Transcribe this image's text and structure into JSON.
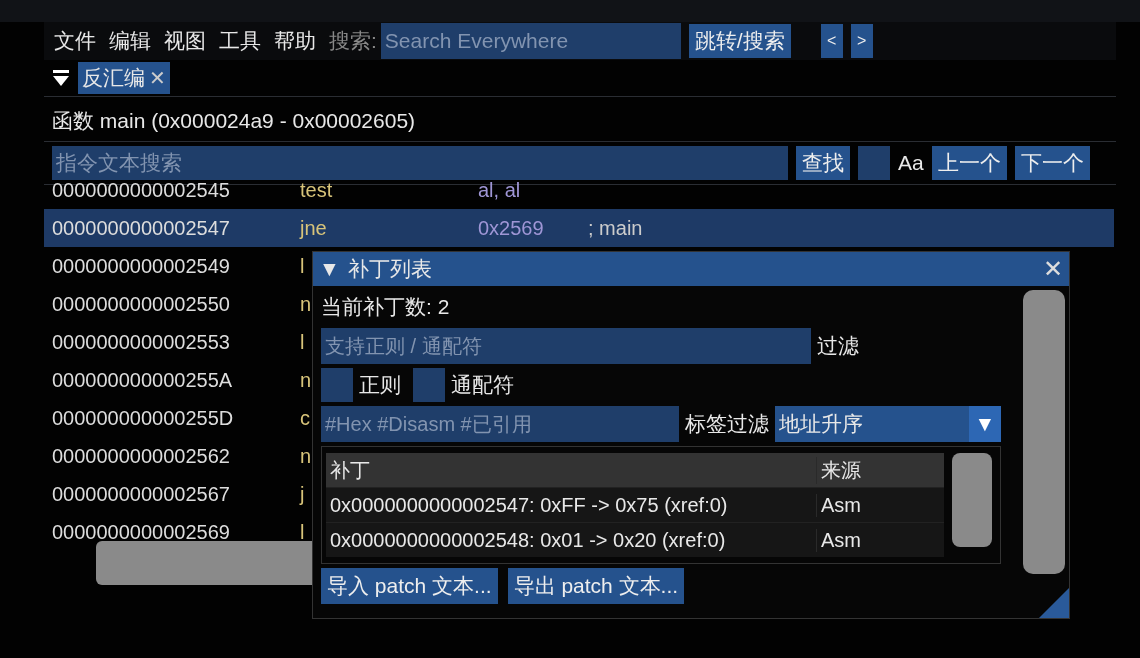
{
  "menu": [
    {
      "label": "文件"
    },
    {
      "label": "编辑"
    },
    {
      "label": "视图"
    },
    {
      "label": "工具"
    },
    {
      "label": "帮助"
    }
  ],
  "search": {
    "label": "搜索:",
    "placeholder": "Search Everywhere",
    "button": "跳转/搜索",
    "back": "<",
    "forward": ">"
  },
  "tabs": [
    {
      "label": "反汇编",
      "selected": true,
      "close": "✕"
    }
  ],
  "function_header": "函数 main  (0x000024a9 - 0x00002605)",
  "find": {
    "placeholder": "指令文本搜索",
    "button": "查找",
    "case_label": "Aa",
    "case_checked": false,
    "prev": "上一个",
    "next": "下一个"
  },
  "rows": [
    {
      "address": "0000000000002545",
      "mnemonic": "test",
      "operands": "al, al",
      "comment": "",
      "selected": false
    },
    {
      "address": "0000000000002547",
      "mnemonic": "jne",
      "operands": "0x2569",
      "comment": "; main",
      "selected": true
    },
    {
      "address": "0000000000002549",
      "mnemonic": "l",
      "operands": "",
      "comment": "",
      "selected": false
    },
    {
      "address": "0000000000002550",
      "mnemonic": "n",
      "operands": "",
      "comment": "",
      "selected": false
    },
    {
      "address": "0000000000002553",
      "mnemonic": "l",
      "operands": "",
      "comment": "",
      "selected": false
    },
    {
      "address": "000000000000255A",
      "mnemonic": "n",
      "operands": "",
      "comment": "",
      "selected": false
    },
    {
      "address": "000000000000255D",
      "mnemonic": "c",
      "operands": "",
      "comment": "",
      "selected": false
    },
    {
      "address": "0000000000002562",
      "mnemonic": "n",
      "operands": "",
      "comment": "",
      "selected": false
    },
    {
      "address": "0000000000002567",
      "mnemonic": "j",
      "operands": "",
      "comment": "",
      "selected": false
    },
    {
      "address": "0000000000002569",
      "mnemonic": "l",
      "operands": "",
      "comment": "",
      "selected": false
    }
  ],
  "patch_dialog": {
    "title": "补丁列表",
    "collapse": "▼",
    "close": "✕",
    "count": "当前补丁数: 2",
    "filter_placeholder": "支持正则 / 通配符",
    "filter_label": "过滤",
    "options": [
      {
        "label": "正则",
        "checked": false
      },
      {
        "label": "通配符",
        "checked": false
      }
    ],
    "tag_placeholder": "#Hex #Disasm #已引用",
    "tag_label": "标签过滤",
    "sort": "地址升序",
    "sort_arrow": "▼",
    "columns": [
      "补丁",
      "来源"
    ],
    "patches": [
      {
        "patch": "0x0000000000002547: 0xFF -> 0x75 (xref:0)",
        "source": "Asm"
      },
      {
        "patch": "0x0000000000002548: 0x01 -> 0x20 (xref:0)",
        "source": "Asm"
      }
    ],
    "buttons": [
      "导入 patch 文本...",
      "导出 patch 文本..."
    ]
  }
}
